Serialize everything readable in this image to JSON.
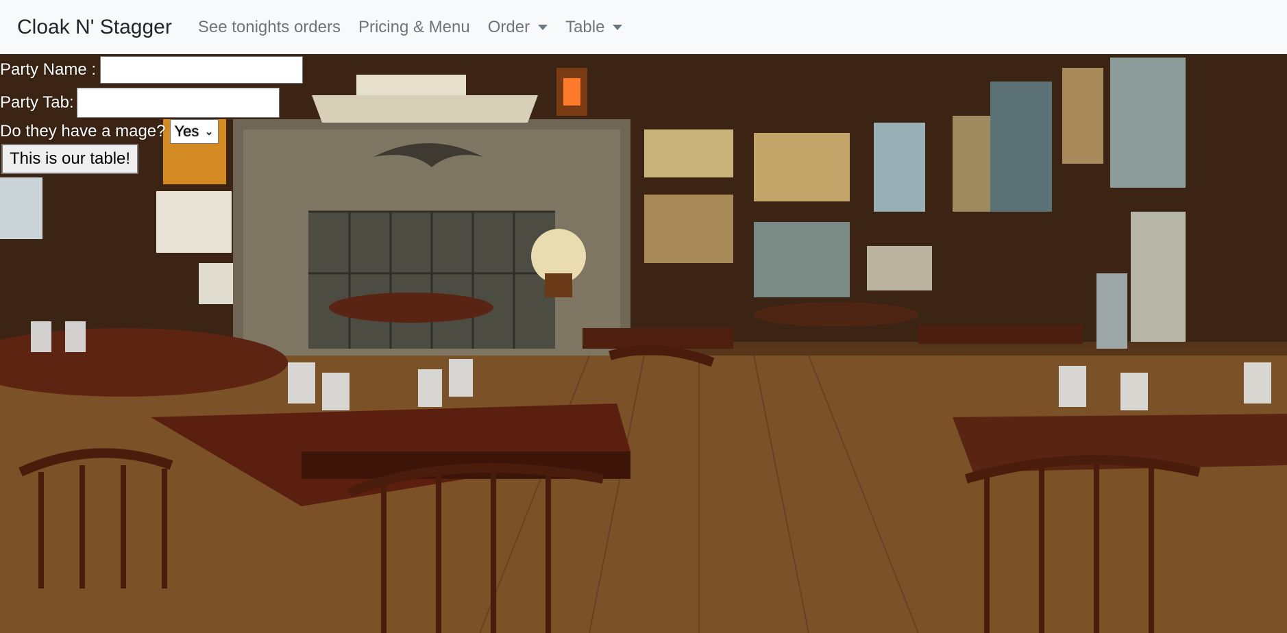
{
  "navbar": {
    "brand": "Cloak N' Stagger",
    "links": [
      {
        "label": "See tonights orders"
      },
      {
        "label": "Pricing & Menu"
      },
      {
        "label": "Order"
      },
      {
        "label": "Table"
      }
    ]
  },
  "form": {
    "party_name_label": "Party Name :",
    "party_name_value": "",
    "party_tab_label": "Party Tab:",
    "party_tab_value": "",
    "mage_label": "Do they have a mage?",
    "mage_selected": "Yes",
    "submit_label": "This is our table!"
  },
  "colors": {
    "navbar_bg": "#f8f9fa",
    "brand_text": "#212529",
    "nav_text": "#6c757d"
  },
  "icons": {
    "dropdown": "caret-down-icon"
  }
}
